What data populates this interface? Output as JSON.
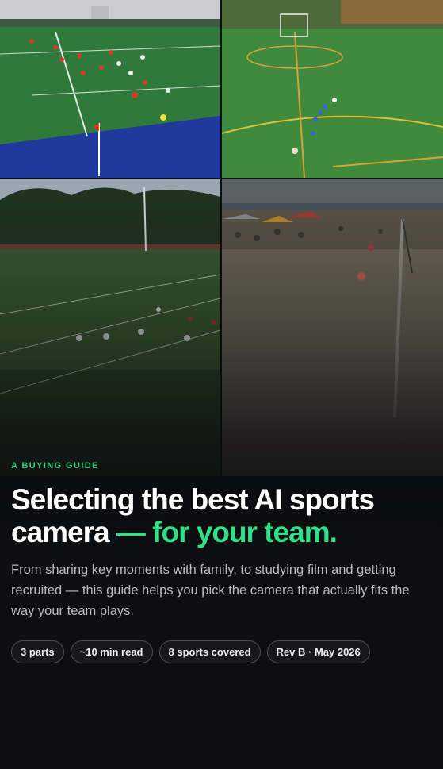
{
  "hero": {
    "eyebrow": "A BUYING GUIDE",
    "headline_main": "Selecting the best AI sports camera",
    "headline_accent": " — for your team.",
    "description": "From sharing key moments with family, to studying film and getting recruited — this guide helps you pick the camera that actually fits the way your team plays.",
    "tiles": [
      {
        "scene": "girls-soccer-scrimmage-on-turf"
      },
      {
        "scene": "soccer-field-from-above"
      },
      {
        "scene": "youth-football-game"
      },
      {
        "scene": "beach-volleyball"
      }
    ]
  },
  "chips": [
    {
      "label": "3 parts"
    },
    {
      "label": "~10 min read"
    },
    {
      "label": "8 sports covered"
    },
    {
      "label": "Rev B · May 2026"
    }
  ],
  "colors": {
    "accent": "#2fe08a",
    "eyebrow": "#35d07f",
    "background": "#0d0e10"
  }
}
